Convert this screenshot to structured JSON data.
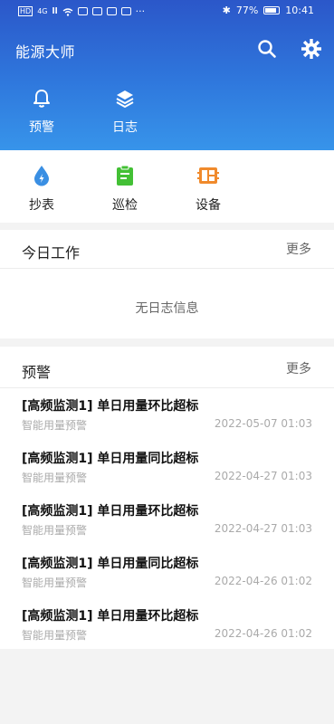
{
  "status_bar": {
    "left_indicators": [
      "HD",
      "4G",
      "ll",
      "wifi"
    ],
    "bluetooth": "✱",
    "battery": "77%",
    "time": "10:41",
    "more": "···"
  },
  "header": {
    "title": "能源大师",
    "search_icon": "search-icon",
    "settings_icon": "gear-icon"
  },
  "quick_actions": [
    {
      "label": "预警",
      "icon": "bell-icon"
    },
    {
      "label": "日志",
      "icon": "layers-icon"
    }
  ],
  "tiles": [
    {
      "label": "抄表",
      "icon": "water-drop-icon",
      "color": "#3a8fe3"
    },
    {
      "label": "巡检",
      "icon": "clipboard-icon",
      "color": "#43c035"
    },
    {
      "label": "设备",
      "icon": "device-icon",
      "color": "#f08a2c"
    }
  ],
  "today": {
    "title": "今日工作",
    "more": "更多",
    "empty": "无日志信息"
  },
  "alerts": {
    "title": "预警",
    "more": "更多",
    "items": [
      {
        "title": "[高频监测1] 单日用量环比超标",
        "source": "智能用量预警",
        "time": "2022-05-07 01:03"
      },
      {
        "title": "[高频监测1] 单日用量同比超标",
        "source": "智能用量预警",
        "time": "2022-04-27 01:03"
      },
      {
        "title": "[高频监测1] 单日用量环比超标",
        "source": "智能用量预警",
        "time": "2022-04-27 01:03"
      },
      {
        "title": "[高频监测1] 单日用量同比超标",
        "source": "智能用量预警",
        "time": "2022-04-26 01:02"
      },
      {
        "title": "[高频监测1] 单日用量环比超标",
        "source": "智能用量预警",
        "time": "2022-04-26 01:02"
      }
    ]
  }
}
